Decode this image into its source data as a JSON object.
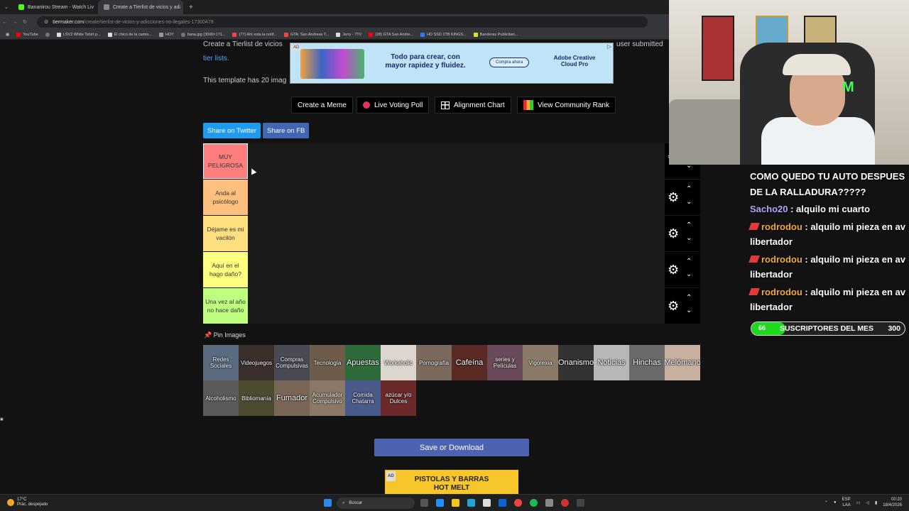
{
  "browser": {
    "tabs": [
      {
        "title": "Bananirou Stream - Watch Liv",
        "color": "#53fc18"
      },
      {
        "title": "Create a Tierlist de vicios y adi",
        "color": "#888888"
      }
    ],
    "new_tab": "+",
    "url_host": "tiermaker.com",
    "url_path": "/create/tierlist-de-vicios-y-adicciones-no-ilegales-17300478",
    "bookmarks": [
      "YouTube",
      "LSV2 White Tshirt p...",
      "El chico de la camis...",
      "HOY",
      "bana.jpg (3000×171...",
      "(77) Ahí esta la notif...",
      "GTA: San Andreas T...",
      "Jerry - 7TV",
      "(28) GTA San Andre...",
      "HD SSD 1TB KINGS...",
      "Banderas Publicitari..."
    ]
  },
  "page": {
    "intro_line1": "Create a Tierlist de vicios",
    "intro_right": "user submitted",
    "intro_link": "tier lists.",
    "intro_line2": "This template has 20 imag",
    "ad_top": {
      "tag": "AD",
      "text": "Todo para crear, con mayor rapidez y fluidez.",
      "button": "Compra ahora",
      "brand": "Adobe Creative Cloud Pro"
    },
    "tools": {
      "meme": "Create a Meme",
      "poll": "Live Voting Poll",
      "alignment": "Alignment Chart",
      "rank": "View Community Rank"
    },
    "share_twitter": "Share on Twitter",
    "share_fb": "Share on FB",
    "tiers": [
      {
        "label": "MUY PELIGROSA",
        "color": "#ff7f7f"
      },
      {
        "label": "Anda al psicólogo",
        "color": "#ffbf7f"
      },
      {
        "label": "Déjame es mi vacilón",
        "color": "#ffdf7f"
      },
      {
        "label": "Aquí en el hago daño?",
        "color": "#ffff7f"
      },
      {
        "label": "Una vez al año no hace daño",
        "color": "#bfff7f"
      }
    ],
    "pin_images": "Pin Images",
    "images": [
      "Redes Sociales",
      "Videojuegos",
      "Compras Compulsivas",
      "Tecnología",
      "Apuestas",
      "Workaholic",
      "Pornografía",
      "Cafeína",
      "series y Películas",
      "Vigorexia",
      "Onanismo",
      "Noticias",
      "Hinchas",
      "Melómano",
      "Alcoholismo",
      "Bibliomanía",
      "Fumador",
      "Acumulador Compulsivo",
      "Comida Chatarra",
      "azúcar y/o Dulces"
    ],
    "save_button": "Save or Download",
    "ad_bottom": {
      "tag": "AD",
      "text": "PISTOLAS Y BARRAS HOT MELT"
    }
  },
  "stream": {
    "chat": [
      {
        "user": "",
        "text": "COMO QUEDO TU AUTO DESPUES DE LA RALLADURA?????"
      },
      {
        "user": "Sacho20",
        "text": ": alquilo mi cuarto"
      },
      {
        "user": "rodrodou",
        "text": ": alquilo mi pieza en av libertador"
      },
      {
        "user": "rodrodou",
        "text": ": alquilo mi pieza en av libertador"
      },
      {
        "user": "rodrodou",
        "text": ": alquilo mi pieza en av libertador"
      }
    ],
    "sub_current": "66",
    "sub_label": "SUSCRIPTORES DEL MES",
    "sub_goal": "300",
    "sub_fraction": 0.22
  },
  "taskbar": {
    "temp": "17°C",
    "weather": "Prác. despejado",
    "search": "Buscar",
    "lang": "ESP",
    "lang2": "LAA",
    "time": "00:20",
    "date": "18/4/2026"
  }
}
